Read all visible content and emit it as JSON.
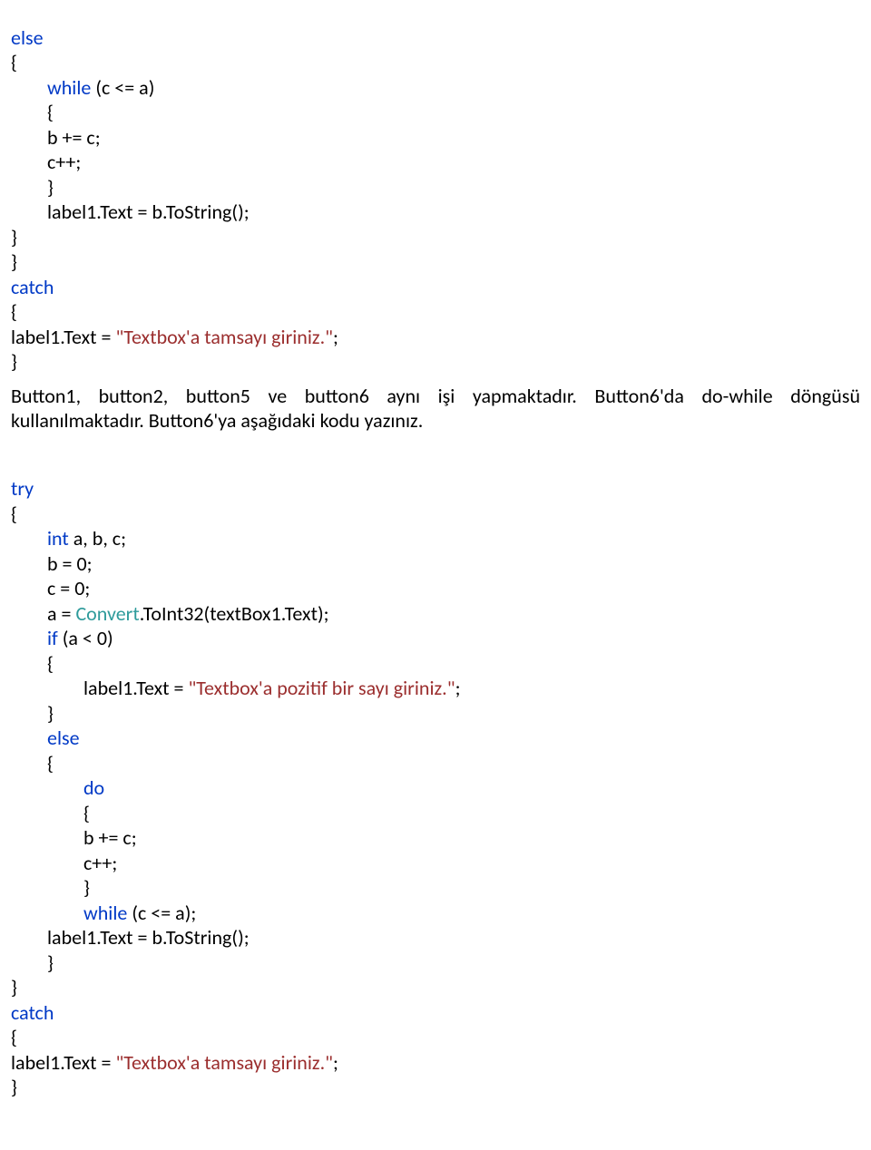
{
  "snippet1": {
    "line1": "else",
    "line2": "{",
    "line3a": "while",
    "line3b": " (c <= a)",
    "line4": "{",
    "line5": "b += c;",
    "line6": "c++;",
    "line7": "}",
    "line8": "label1.Text = b.ToString();",
    "line9": "}",
    "line10": "}",
    "line11": "catch",
    "line12": "{",
    "line13a": "label1.Text = ",
    "line13b": "\"Textbox'a tamsayı giriniz.\"",
    "line13c": ";",
    "line14": "}"
  },
  "paragraph": "Button1, button2, button5 ve button6 aynı işi yapmaktadır. Button6'da do-while döngüsü kullanılmaktadır. Button6'ya aşağıdaki kodu yazınız.",
  "snippet2": {
    "line1": "try",
    "line2": "{",
    "line3a": "int",
    "line3b": " a, b, c;",
    "line4": "b = 0;",
    "line5": "c = 0;",
    "line6a": "a = ",
    "line6b": "Convert",
    "line6c": ".ToInt32(textBox1.Text);",
    "line7a": "if",
    "line7b": " (a < 0)",
    "line8": "{",
    "line9a": "label1.Text = ",
    "line9b": "\"Textbox'a pozitif bir sayı giriniz.\"",
    "line9c": ";",
    "line10": "}",
    "line11": "else",
    "line12": "{",
    "line13": "do",
    "line14": "{",
    "line15": "b += c;",
    "line16": "c++;",
    "line17": "}",
    "line18a": "while",
    "line18b": " (c <= a);",
    "line19": "label1.Text = b.ToString();",
    "line20": "}",
    "line21": "}",
    "line22": "catch",
    "line23": "{",
    "line24a": "label1.Text = ",
    "line24b": "\"Textbox'a tamsayı giriniz.\"",
    "line24c": ";",
    "line25": "}"
  }
}
